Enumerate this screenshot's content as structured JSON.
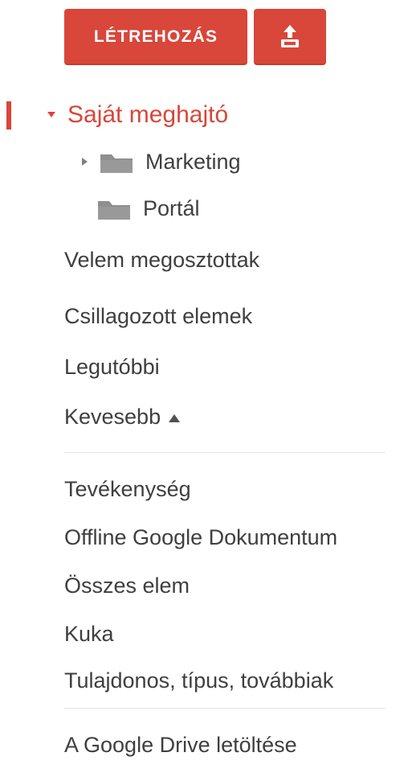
{
  "header": {
    "create_label": "LÉTREHOZÁS",
    "upload_icon": "upload-icon"
  },
  "nav": {
    "my_drive": "Saját meghajtó",
    "folders": [
      {
        "label": "Marketing",
        "has_children": true
      },
      {
        "label": "Portál",
        "has_children": false
      }
    ],
    "shared_with_me": "Velem megosztottak",
    "starred": "Csillagozott elemek",
    "recent": "Legutóbbi",
    "less": "Kevesebb",
    "activity": "Tevékenység",
    "offline_docs": "Offline Google Dokumentum",
    "all_items": "Összes elem",
    "trash": "Kuka",
    "owner_type_more": "Tulajdonos, típus, továbbiak",
    "download_drive": "A Google Drive letöltése"
  },
  "colors": {
    "accent": "#d9463a",
    "text": "#3f3f3f",
    "folder": "#8f8f8f"
  }
}
